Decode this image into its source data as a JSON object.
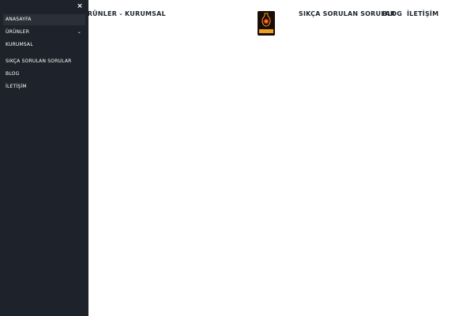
{
  "header": {
    "products_label": "ÜRÜNLER",
    "corporate_label": "KURUMSAL",
    "faq_label": "SIKÇA SORULAN SORULAR",
    "blog_label": "BLOG",
    "contact_label": "İLETİŞİM",
    "logo_text": "Şelales"
  },
  "drawer": {
    "close_icon": "×",
    "items": [
      {
        "label": "ANASAYFA",
        "active": true
      },
      {
        "label": "ÜRÜNLER",
        "has_submenu": true
      },
      {
        "label": "KURUMSAL"
      },
      {
        "label": "SIKÇA SORULAN SORULAR"
      },
      {
        "label": "BLOG"
      },
      {
        "label": "İLETİŞİM"
      }
    ],
    "chevron_icon": "⌄"
  },
  "colors": {
    "drawer_bg": "#1e222a",
    "drawer_active_bg": "#2b3038",
    "nav_text": "#1d232c",
    "logo_bg": "#1a0d06",
    "logo_accent": "#f0a020"
  }
}
